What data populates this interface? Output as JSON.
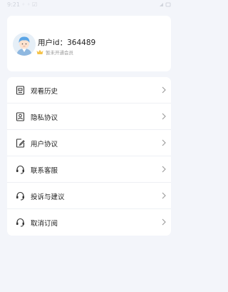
{
  "status_bar": {
    "time": "9:21 ◦ ◦ ☑"
  },
  "profile": {
    "user_id_label": "用户id：",
    "user_id_value": "364489",
    "vip_status": "暂未开通会员",
    "avatar_icon": "user-avatar-icon",
    "crown_icon": "crown-icon"
  },
  "menu": {
    "items": [
      {
        "label": "观看历史",
        "icon": "history-icon"
      },
      {
        "label": "隐私协议",
        "icon": "privacy-icon"
      },
      {
        "label": "用户协议",
        "icon": "agreement-icon"
      },
      {
        "label": "联系客服",
        "icon": "headset-icon"
      },
      {
        "label": "投诉与建议",
        "icon": "headset-icon"
      },
      {
        "label": "取消订阅",
        "icon": "headset-icon"
      }
    ]
  },
  "colors": {
    "background": "#f3f5fa",
    "card": "#ffffff",
    "crown": "#f5c34a",
    "chevron": "#9a9a9a"
  }
}
